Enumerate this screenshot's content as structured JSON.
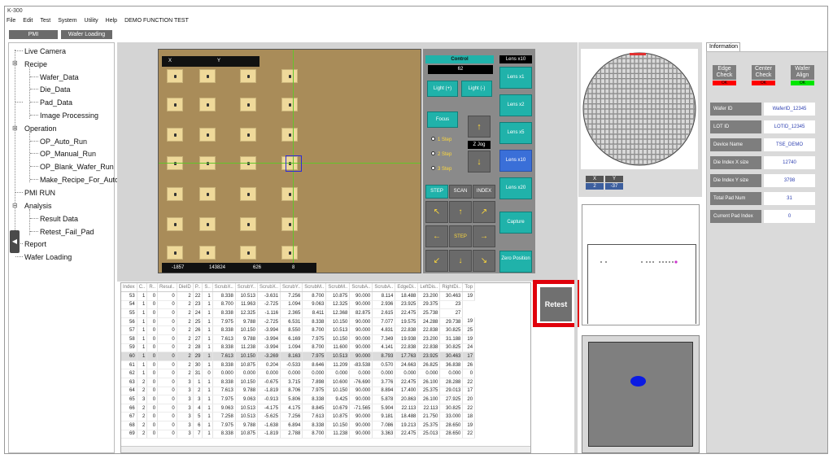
{
  "window_title": "K-300",
  "menu": [
    "File",
    "Edit",
    "Test",
    "System",
    "Utility",
    "Help",
    "DEMO FUNCTION TEST"
  ],
  "toolbar": {
    "pmi": "PMI",
    "wafer_loading": "Wafer Loading"
  },
  "tree": {
    "live_camera": "Live Camera",
    "recipe": "Recipe",
    "wafer_data": "Wafer_Data",
    "die_data": "Die_Data",
    "pad_data": "Pad_Data",
    "image_processing": "Image Processing",
    "operation": "Operation",
    "op_auto_run": "OP_Auto_Run",
    "op_manual_run": "OP_Manual_Run",
    "op_blank_wafer_run": "OP_Blank_Wafer_Run",
    "make_recipe_for_auto": "Make_Recipe_For_Auto",
    "pmi_run": "PMI RUN",
    "analysis": "Analysis",
    "result_data": "Result Data",
    "retest_fail_pad": "Retest_Fail_Pad",
    "report": "Report",
    "wafer_loading": "Wafer Loading"
  },
  "camera": {
    "x_label": "X",
    "y_label": "Y",
    "status": [
      "-1857",
      "143824",
      "626",
      "8"
    ]
  },
  "control": {
    "title": "Control",
    "value": "62",
    "light_plus": "Light (+)",
    "light_minus": "Light (-)",
    "focus": "Focus",
    "step1": "1 Step",
    "step2": "2 Step",
    "step3": "3 Step",
    "z_jog": "Z Jog",
    "step": "STEP",
    "scan": "SCAN",
    "index": "INDEX",
    "center_step": "STEP"
  },
  "lens": {
    "title": "Lens x10",
    "x1": "Lens x1",
    "x2": "Lens x2",
    "x5": "Lens x5",
    "x10": "Lens x10",
    "x20": "Lens x20",
    "capture": "Capture",
    "zero": "Zero Position"
  },
  "table": {
    "headers": [
      "Index",
      "C..",
      "R..",
      "Resul..",
      "DieID",
      "P..",
      "S..",
      "ScrubX..",
      "ScrubY..",
      "ScrubX..",
      "ScrubY..",
      "ScrubM..",
      "ScrubM..",
      "ScrubA..",
      "ScrubA..",
      "EdgeDi..",
      "LeftDis..",
      "RightDi..",
      "Top"
    ],
    "rows": [
      [
        "53",
        "1",
        "0",
        "0",
        "2",
        "22",
        "1",
        "8.338",
        "10.513",
        "-3.631",
        "7.256",
        "8.700",
        "10.875",
        "90.000",
        "8.114",
        "18.488",
        "23.200",
        "30.463",
        "19"
      ],
      [
        "54",
        "1",
        "0",
        "0",
        "2",
        "23",
        "1",
        "8.700",
        "11.963",
        "-2.725",
        "1.094",
        "9.063",
        "12.325",
        "90.000",
        "2.936",
        "23.925",
        "29.375",
        "23"
      ],
      [
        "55",
        "1",
        "0",
        "0",
        "2",
        "24",
        "1",
        "8.338",
        "12.325",
        "-1.116",
        "2.365",
        "8.411",
        "12.368",
        "82.875",
        "2.615",
        "22.475",
        "25.738",
        "27"
      ],
      [
        "56",
        "1",
        "0",
        "0",
        "2",
        "25",
        "1",
        "7.975",
        "9.788",
        "-2.725",
        "6.531",
        "8.338",
        "10.150",
        "90.000",
        "7.077",
        "19.575",
        "24.288",
        "29.738",
        "19"
      ],
      [
        "57",
        "1",
        "0",
        "0",
        "2",
        "26",
        "1",
        "8.338",
        "10.150",
        "-3.994",
        "8.550",
        "8.700",
        "10.513",
        "90.000",
        "4.831",
        "22.838",
        "22.838",
        "30.825",
        "25"
      ],
      [
        "58",
        "1",
        "0",
        "0",
        "2",
        "27",
        "1",
        "7.613",
        "9.788",
        "-3.994",
        "6.169",
        "7.975",
        "10.150",
        "90.000",
        "7.349",
        "19.938",
        "23.200",
        "31.188",
        "19"
      ],
      [
        "59",
        "1",
        "0",
        "0",
        "2",
        "28",
        "1",
        "8.338",
        "11.238",
        "-3.994",
        "1.094",
        "8.700",
        "11.600",
        "90.000",
        "4.141",
        "22.838",
        "22.838",
        "30.825",
        "24"
      ],
      [
        "60",
        "1",
        "0",
        "0",
        "2",
        "29",
        "1",
        "7.613",
        "10.150",
        "-3.269",
        "8.163",
        "7.975",
        "10.513",
        "90.000",
        "8.793",
        "17.763",
        "23.925",
        "30.463",
        "17"
      ],
      [
        "61",
        "1",
        "0",
        "0",
        "2",
        "30",
        "1",
        "8.338",
        "10.875",
        "0.204",
        "-0.533",
        "8.646",
        "11.209",
        "-83.538",
        "0.570",
        "24.663",
        "26.825",
        "36.838",
        "26"
      ],
      [
        "62",
        "1",
        "0",
        "0",
        "2",
        "31",
        "0",
        "0.000",
        "0.000",
        "0.000",
        "0.000",
        "0.000",
        "0.000",
        "0.000",
        "0.000",
        "0.000",
        "0.000",
        "0.000",
        "0"
      ],
      [
        "63",
        "2",
        "0",
        "0",
        "3",
        "1",
        "1",
        "8.338",
        "10.150",
        "-0.675",
        "3.715",
        "7.898",
        "10.600",
        "-76.690",
        "3.776",
        "22.475",
        "26.100",
        "28.288",
        "22"
      ],
      [
        "64",
        "2",
        "0",
        "0",
        "3",
        "2",
        "1",
        "7.613",
        "9.788",
        "-1.819",
        "8.706",
        "7.975",
        "10.150",
        "90.000",
        "8.894",
        "17.400",
        "25.375",
        "29.013",
        "17"
      ],
      [
        "65",
        "3",
        "0",
        "0",
        "3",
        "3",
        "1",
        "7.975",
        "9.063",
        "-0.913",
        "5.806",
        "8.338",
        "9.425",
        "90.000",
        "5.878",
        "20.863",
        "26.100",
        "27.925",
        "20"
      ],
      [
        "66",
        "2",
        "0",
        "0",
        "3",
        "4",
        "1",
        "9.063",
        "10.513",
        "-4.175",
        "4.175",
        "8.845",
        "10.679",
        "-71.565",
        "5.904",
        "22.113",
        "22.113",
        "30.825",
        "22"
      ],
      [
        "67",
        "2",
        "0",
        "0",
        "3",
        "5",
        "1",
        "7.258",
        "10.513",
        "-5.625",
        "7.256",
        "7.613",
        "10.875",
        "90.000",
        "9.181",
        "18.488",
        "21.750",
        "33.000",
        "18"
      ],
      [
        "68",
        "2",
        "0",
        "0",
        "3",
        "6",
        "1",
        "7.975",
        "9.788",
        "-1.638",
        "6.894",
        "8.338",
        "10.150",
        "90.000",
        "7.086",
        "19.213",
        "25.375",
        "28.650",
        "19"
      ],
      [
        "69",
        "2",
        "0",
        "0",
        "3",
        "7",
        "1",
        "8.338",
        "10.875",
        "-1.819",
        "2.788",
        "8.700",
        "11.238",
        "90.000",
        "3.363",
        "22.475",
        "25.013",
        "28.650",
        "22"
      ]
    ],
    "selected_row": 7
  },
  "retest_button": "Retest",
  "wafer_coords": {
    "x_label": "X",
    "y_label": "Y",
    "x_value": "2",
    "y_value": "-37"
  },
  "info": {
    "tab": "Information",
    "edge_check": "Edge Check",
    "center_check": "Center Check",
    "wafer_align": "Wafer Align",
    "edge_status": "OK",
    "center_status": "OK",
    "align_status": "OK",
    "status_colors": {
      "edge": "#ff0000",
      "center": "#ff0000",
      "align": "#00e600"
    },
    "fields": [
      {
        "label": "Wafer ID",
        "value": "WaferID_12345"
      },
      {
        "label": "LOT ID",
        "value": "LOTID_12345"
      },
      {
        "label": "Device Name",
        "value": "TSE_DEMO"
      },
      {
        "label": "Die Index X size",
        "value": "12740"
      },
      {
        "label": "Die Index Y size",
        "value": "3798"
      },
      {
        "label": "Total Pad Num",
        "value": "31"
      },
      {
        "label": "Current Pad Index",
        "value": "0"
      }
    ]
  },
  "colors": {
    "accent_teal": "#20b2aa",
    "lens_selected": "#3a6fd8",
    "retest_highlight": "#e0000b"
  }
}
